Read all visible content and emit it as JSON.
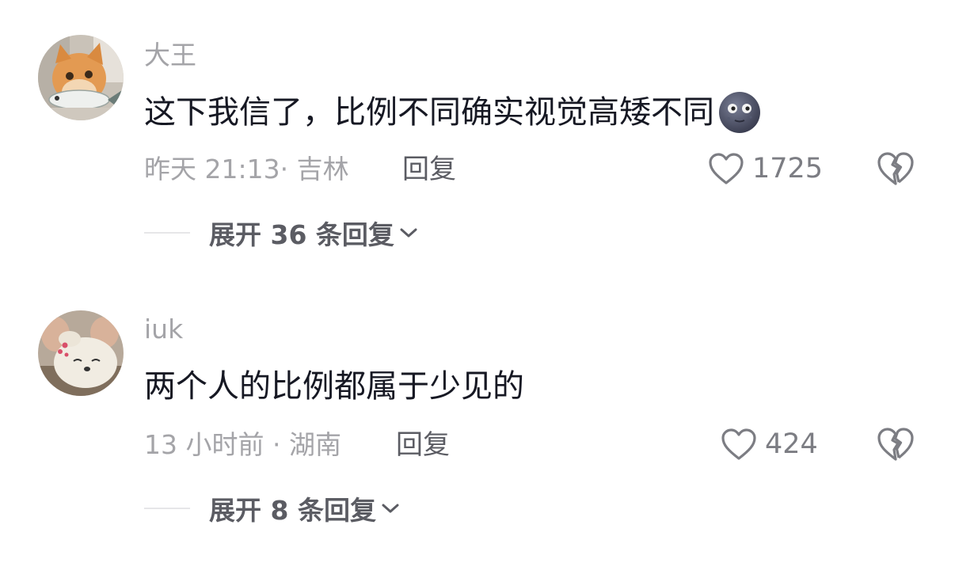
{
  "comments": [
    {
      "username": "大王",
      "text": "这下我信了，比例不同确实视觉高矮不同",
      "emoji_icon": "new-moon-face-icon",
      "time_location": "昨天 21:13· 吉林",
      "reply_label": "回复",
      "likes": "1725",
      "expand_label": "展开 36 条回复",
      "avatar_icon": "orange-cat-with-fish-toy-avatar"
    },
    {
      "username": "iuk",
      "text": "两个人的比例都属于少见的",
      "time_location": "13 小时前 · 湖南",
      "reply_label": "回复",
      "likes": "424",
      "expand_label": "展开 8 条回复",
      "avatar_icon": "plush-toy-held-by-hand-avatar"
    }
  ],
  "icons": {
    "like": "heart-outline-icon",
    "dislike": "broken-heart-icon",
    "expand": "chevron-down-icon"
  },
  "colors": {
    "primary_text": "#161823",
    "secondary_text": "#a4a4a8",
    "action_text": "#5b5c63"
  }
}
